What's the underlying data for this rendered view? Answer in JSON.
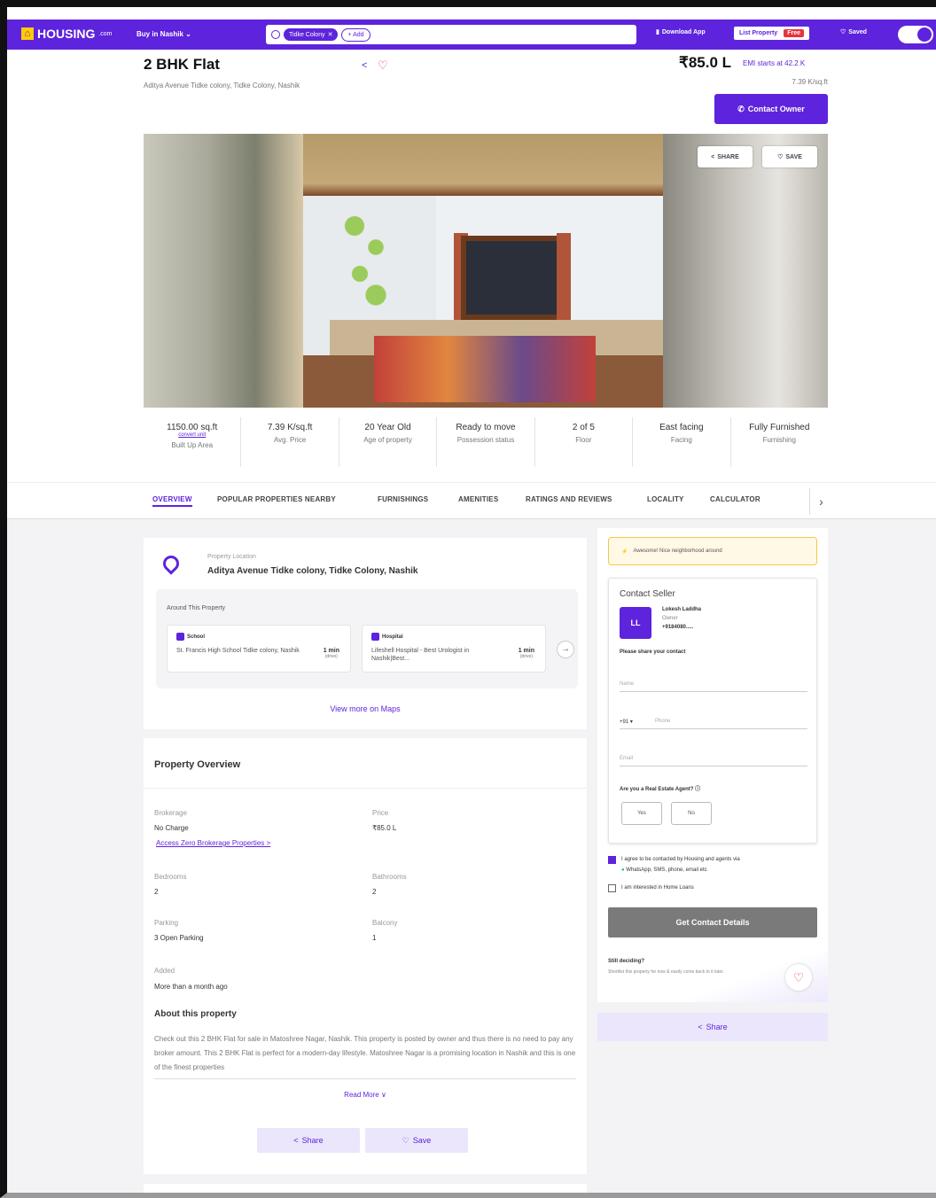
{
  "header": {
    "logo_text": "HOUSING",
    "logo_suffix": ".com",
    "city_select": "Buy in Nashik",
    "search_chip": "Tidke Colony",
    "search_add": "+ Add",
    "download_app": "Download App",
    "list_property": "List Property",
    "free_badge": "Free",
    "saved": "Saved",
    "brand_color": "#5e23dc"
  },
  "listing": {
    "title": "2 BHK Flat",
    "address": "Aditya Avenue Tidke colony, Tidke Colony, Nashik",
    "price": "₹85.0 L",
    "emi_text": "EMI starts at 42.2 K",
    "rate": "7.39 K/sq.ft",
    "contact_owner": "Contact Owner"
  },
  "gallery": {
    "share_label": "SHARE",
    "save_label": "SAVE"
  },
  "facts": [
    {
      "value": "1150.00 sq.ft",
      "sub": "convert unit",
      "label": "Built Up Area"
    },
    {
      "value": "7.39 K/sq.ft",
      "label": "Avg. Price"
    },
    {
      "value": "20 Year Old",
      "label": "Age of property"
    },
    {
      "value": "Ready to move",
      "label": "Possession status"
    },
    {
      "value": "2 of 5",
      "label": "Floor"
    },
    {
      "value": "East facing",
      "label": "Facing"
    },
    {
      "value": "Fully Furnished",
      "label": "Furnishing"
    }
  ],
  "tabs": [
    "OVERVIEW",
    "POPULAR PROPERTIES NEARBY",
    "FURNISHINGS",
    "AMENITIES",
    "RATINGS AND REVIEWS",
    "LOCALITY",
    "CALCULATOR"
  ],
  "location": {
    "label": "Property Location",
    "value": "Aditya Avenue Tidke colony, Tidke Colony, Nashik",
    "around_title": "Around This Property",
    "pois": [
      {
        "type": "School",
        "name": "St. Francis High School Tidke colony, Nashik",
        "time": "1 min",
        "mode": "(drive)"
      },
      {
        "type": "Hospital",
        "name": "Lifeshell Hospital - Best Urologist in Nashik|Best...",
        "time": "1 min",
        "mode": "(drive)"
      }
    ],
    "view_maps": "View more on Maps"
  },
  "overview": {
    "title": "Property Overview",
    "brokerage_label": "Brokerage",
    "brokerage_value": "No Charge",
    "zero_link": "Access Zero Brokerage Properties >",
    "price_label": "Price",
    "price_value": "₹85.0 L",
    "bedrooms_label": "Bedrooms",
    "bedrooms_value": "2",
    "bathrooms_label": "Bathrooms",
    "bathrooms_value": "2",
    "parking_label": "Parking",
    "parking_value": "3 Open Parking",
    "balcony_label": "Balcony",
    "balcony_value": "1",
    "added_label": "Added",
    "added_value": "More than a month ago",
    "about_title": "About this property",
    "about_text": "Check out this 2 BHK Flat for sale in Matoshree Nagar, Nashik. This property is posted by owner and thus there is no need to pay any broker amount. This 2 BHK Flat is perfect for a modern-day lifestyle. Matoshree Nagar is a promising location in Nashik and this is one of the finest properties",
    "read_more": "Read More ∨",
    "share": "Share",
    "save": "Save"
  },
  "contact": {
    "notice": "Awesome! Nice neighborhood around",
    "seller_title": "Contact Seller",
    "initials": "LL",
    "seller_name": "Lokesh Laddha",
    "seller_role": "Owner",
    "seller_phone": "+9184080.....",
    "share_prompt": "Please share your contact",
    "name_placeholder": "Name",
    "phone_code": "+91 ▾",
    "phone_placeholder": "Phone",
    "email_placeholder": "Email",
    "agent_question": "Are you a Real Estate Agent?",
    "yes": "Yes",
    "no": "No",
    "consent_text": "I agree to be contacted by Housing and agents via",
    "consent_text2": "WhatsApp, SMS, phone, email etc",
    "home_loan_text": "I am interested in Home Loans",
    "get_details": "Get Contact Details",
    "still_title": "Still deciding?",
    "still_text": "Shortlist this property for now & easily come back to it later.",
    "share": "Share"
  }
}
